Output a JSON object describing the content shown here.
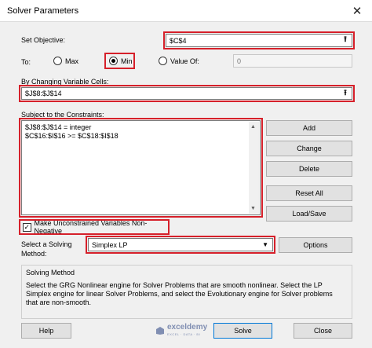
{
  "window": {
    "title": "Solver Parameters"
  },
  "objective": {
    "label": "Set Objective:",
    "value": "$C$4"
  },
  "to": {
    "label": "To:",
    "options": [
      {
        "label": "Max",
        "selected": false
      },
      {
        "label": "Min",
        "selected": true
      },
      {
        "label": "Value Of:",
        "selected": false
      }
    ],
    "value_of": "0"
  },
  "variables": {
    "label": "By Changing Variable Cells:",
    "value": "$J$8:$J$14"
  },
  "constraints": {
    "label": "Subject to the Constraints:",
    "items": [
      "$J$8:$J$14 = integer",
      "$C$16:$I$16 >= $C$18:$I$18"
    ]
  },
  "constraint_buttons": {
    "add": "Add",
    "change": "Change",
    "delete": "Delete",
    "reset_all": "Reset All",
    "load_save": "Load/Save"
  },
  "nonneg": {
    "label": "Make Unconstrained Variables Non-Negative",
    "checked": true
  },
  "method": {
    "label_line1": "Select a Solving",
    "label_line2": "Method:",
    "value": "Simplex LP",
    "options_button": "Options"
  },
  "solving_method": {
    "title": "Solving Method",
    "text": "Select the GRG Nonlinear engine for Solver Problems that are smooth nonlinear. Select the LP Simplex engine for linear Solver Problems, and select the Evolutionary engine for Solver problems that are non-smooth."
  },
  "watermark": {
    "name": "exceldemy",
    "tagline": "EXCEL · DATA · BI"
  },
  "footer": {
    "help": "Help",
    "solve": "Solve",
    "close": "Close"
  },
  "colors": {
    "highlight": "#d6202a",
    "window_bg": "#f0f0f0"
  }
}
